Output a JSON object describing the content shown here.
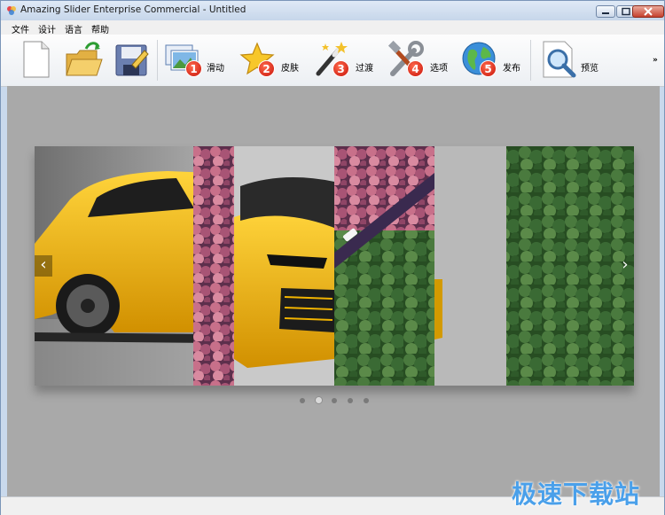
{
  "window": {
    "title": "Amazing Slider Enterprise Commercial - Untitled"
  },
  "menu": [
    "文件",
    "设计",
    "语言",
    "帮助"
  ],
  "toolbar": {
    "new_label": "",
    "open_label": "",
    "save_label": "",
    "slides_label": "滑动",
    "skins_label": "皮肤",
    "transitions_label": "过渡",
    "options_label": "选项",
    "publish_label": "发布",
    "preview_label": "预览",
    "overflow": "»",
    "step_badges": [
      "1",
      "2",
      "3",
      "4",
      "5"
    ]
  },
  "slider": {
    "prev_arrow": "‹",
    "next_arrow": "›",
    "dot_count": 5,
    "active_dot_index": 1
  },
  "watermark": "极速下载站",
  "colors": {
    "canvas_bg": "#a9a9a9",
    "car_yellow": "#f2b400",
    "forest_green": "#2f5a2a",
    "tree_pink": "#c8708a",
    "badge_red": "#d9261c",
    "watermark_blue": "#4aa0ea"
  }
}
